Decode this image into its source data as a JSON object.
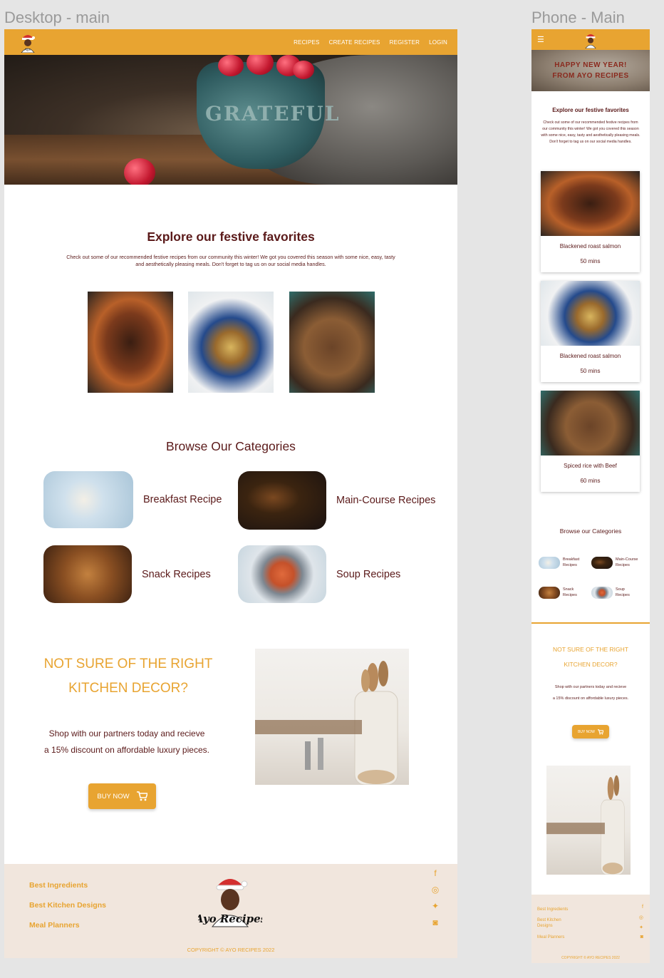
{
  "frames": {
    "desktop_title": "Desktop - main",
    "phone_title": "Phone - Main"
  },
  "brand": {
    "primary": "#e8a431",
    "text": "#5b1a1a",
    "footer_bg": "#f1e6dd",
    "logo_text": "Ayo Recipes"
  },
  "nav": {
    "links": [
      "RECIPES",
      "CREATE RECIPES",
      "REGISTER",
      "LOGIN"
    ],
    "menu_icon": "hamburger-icon"
  },
  "hero": {
    "bowl_text": "GRATEFUL",
    "phone_banner": [
      "HAPPY NEW YEAR!",
      "FROM AYO RECIPES"
    ]
  },
  "festive": {
    "title": "Explore our festive favorites",
    "text": "Check out some of our recommended festive recipes from our community this winter! We got you covered this season with some nice, easy, tasty and aesthetically pleasing meals. Don't forget to tag us on our social media handles.",
    "phone_text": "Check out some of our recommended festive recipes from our community this winter! We got you covered this season with some nice, easy, tasty and aesthetically pleasing meals. Don't forget to tag us on our social media handles.",
    "recipes": [
      {
        "name": "Blackened roast salmon",
        "time": "50 mins"
      },
      {
        "name": "Blackened roast salmon",
        "time": "50 mins"
      },
      {
        "name": "Spiced rice with Beef",
        "time": "60 mins"
      }
    ]
  },
  "categories": {
    "title": "Browse Our Categories",
    "phone_title": "Browse our Categories",
    "items": [
      "Breakfast Recipe",
      "Main-Course Recipes",
      "Snack Recipes",
      "Soup Recipes"
    ],
    "phone_items": [
      "Breakfast Recipes",
      "Main-Course Recipes",
      "Snack Recipes",
      "Soup Recipes"
    ]
  },
  "decor": {
    "title_line1": "NOT SURE OF THE RIGHT",
    "title_line2": "KITCHEN DECOR?",
    "text_line1": "Shop with our partners today and recieve",
    "text_line2": "a 15% discount on affordable luxury pieces.",
    "button": "BUY NOW",
    "button_icon": "cart-icon"
  },
  "footer": {
    "links": [
      "Best Ingredients",
      "Best Kitchen Designs",
      "Meal Planners"
    ],
    "social": [
      "facebook-icon",
      "instagram-icon",
      "twitter-icon",
      "discord-icon"
    ],
    "copyright": "COPYRIGHT © AYO RECIPES 2022"
  }
}
